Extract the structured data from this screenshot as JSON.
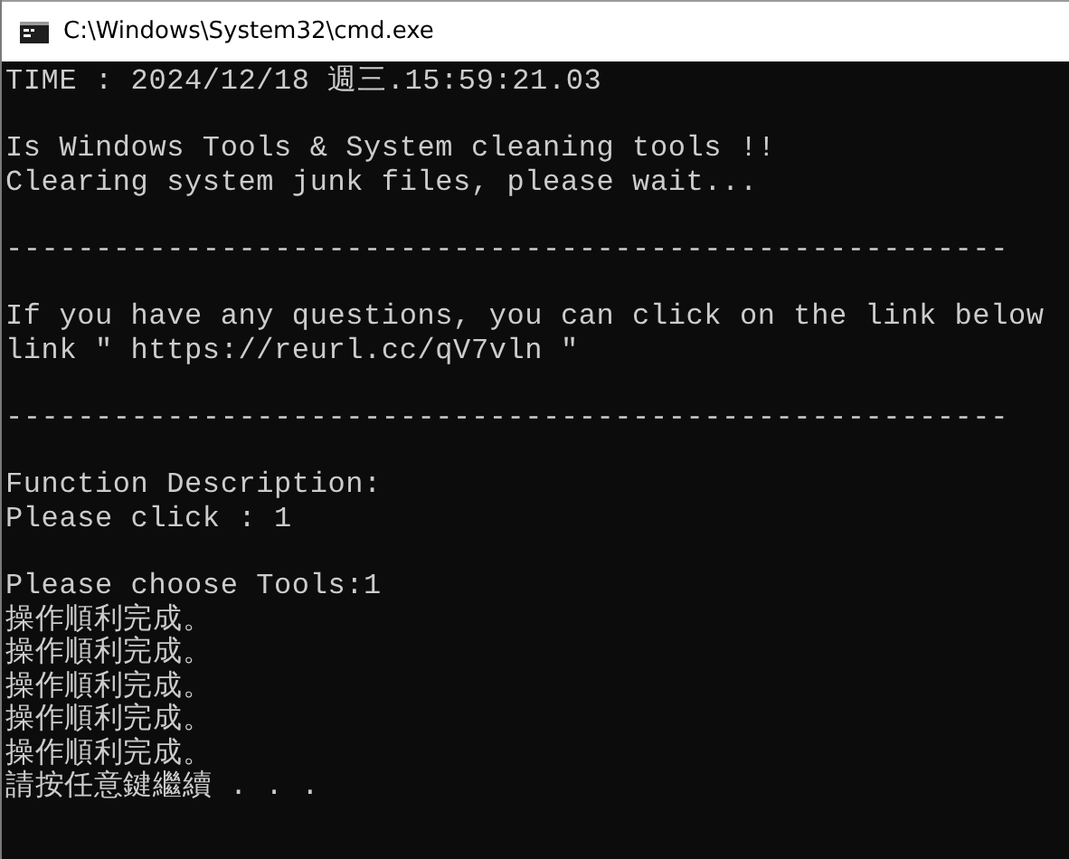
{
  "window": {
    "title": "C:\\Windows\\System32\\cmd.exe"
  },
  "lines": [
    {
      "kind": "text",
      "text": "TIME : 2024/12/18 週三.15:59:21.03"
    },
    {
      "kind": "blank"
    },
    {
      "kind": "text",
      "text": "Is Windows Tools & System cleaning tools !!"
    },
    {
      "kind": "text",
      "text": "Clearing system junk files, please wait..."
    },
    {
      "kind": "blank"
    },
    {
      "kind": "rule",
      "text": "--------------------------------------------------------"
    },
    {
      "kind": "blank"
    },
    {
      "kind": "text",
      "text": "If you have any questions, you can click on the link below"
    },
    {
      "kind": "text",
      "text": "link \" https://reurl.cc/qV7vln \""
    },
    {
      "kind": "blank"
    },
    {
      "kind": "rule",
      "text": "--------------------------------------------------------"
    },
    {
      "kind": "blank"
    },
    {
      "kind": "text",
      "text": "Function Description:"
    },
    {
      "kind": "text",
      "text": "Please click : 1"
    },
    {
      "kind": "blank"
    },
    {
      "kind": "text",
      "text": "Please choose Tools:1"
    },
    {
      "kind": "text",
      "text": "操作順利完成。"
    },
    {
      "kind": "text",
      "text": "操作順利完成。"
    },
    {
      "kind": "text",
      "text": "操作順利完成。"
    },
    {
      "kind": "text",
      "text": "操作順利完成。"
    },
    {
      "kind": "text",
      "text": "操作順利完成。"
    },
    {
      "kind": "text",
      "text": "請按任意鍵繼續 . . ."
    }
  ]
}
